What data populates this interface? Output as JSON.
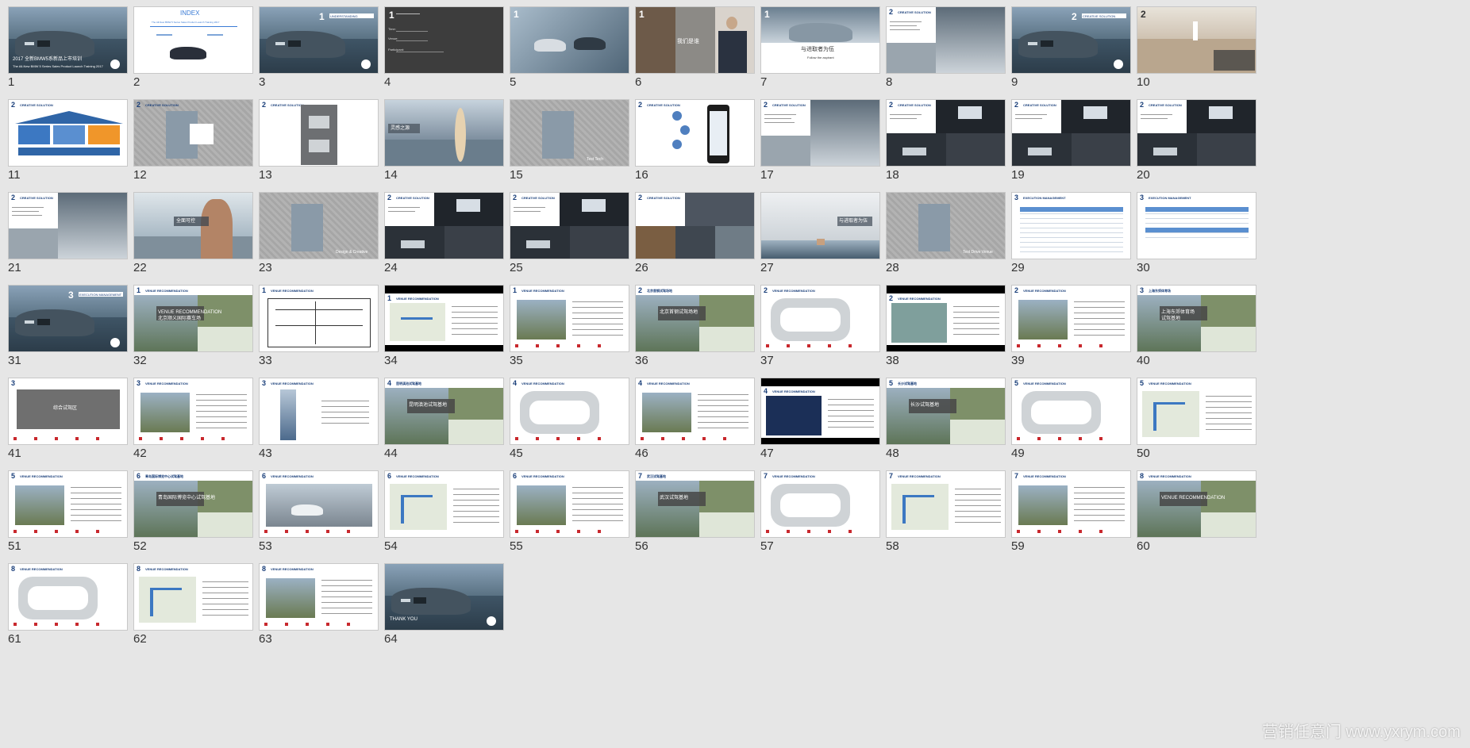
{
  "slides": [
    {
      "n": "1",
      "bg": "#3e5870",
      "texts": [
        "2017 全新BMW5系新品上市培训",
        "The All-New BMW 5 Series Sales Product Launch Training 2017"
      ],
      "kind": "car"
    },
    {
      "n": "2",
      "bg": "#ffffff",
      "texts": [
        "INDEX",
        "The All-New BMW 5 Series Sales Product Launch Training 2017"
      ],
      "kind": "index"
    },
    {
      "n": "3",
      "bg": "#5a7283",
      "texts": [
        "1",
        "UNDERSTANDING"
      ],
      "kind": "car"
    },
    {
      "n": "4",
      "bg": "#3d3d3d",
      "texts": [
        "1",
        "Time:",
        "Venue:",
        "Participant:"
      ],
      "kind": "dark"
    },
    {
      "n": "5",
      "bg": "#6f8597",
      "texts": [
        "1"
      ],
      "kind": "photo"
    },
    {
      "n": "6",
      "bg": "#5c554d",
      "texts": [
        "1",
        "我们是谁"
      ],
      "kind": "people"
    },
    {
      "n": "7",
      "bg": "#ffffff",
      "texts": [
        "1",
        "与进取者为伍",
        "Follow the aspirant"
      ],
      "kind": "car-white"
    },
    {
      "n": "8",
      "bg": "#ffffff",
      "texts": [
        "2",
        "CREATIVE SOLUTION"
      ],
      "kind": "split"
    },
    {
      "n": "9",
      "bg": "#5a7283",
      "texts": [
        "2",
        "CREATIVE SOLUTION"
      ],
      "kind": "car"
    },
    {
      "n": "10",
      "bg": "#c9b9a4",
      "texts": [
        "2"
      ],
      "kind": "sand"
    },
    {
      "n": "11",
      "bg": "#ffffff",
      "texts": [
        "2",
        "CREATIVE SOLUTION"
      ],
      "kind": "house"
    },
    {
      "n": "12",
      "bg": "#a9a9a9",
      "texts": [
        "2",
        "CREATIVE SOLUTION"
      ],
      "kind": "plan"
    },
    {
      "n": "13",
      "bg": "#ffffff",
      "texts": [
        "2",
        "CREATIVE SOLUTION"
      ],
      "kind": "floor"
    },
    {
      "n": "14",
      "bg": "#8a99a8",
      "texts": [
        "灵感之源"
      ],
      "kind": "surf"
    },
    {
      "n": "15",
      "bg": "#a9a9a9",
      "texts": [
        "Test Tech"
      ],
      "kind": "plan"
    },
    {
      "n": "16",
      "bg": "#ffffff",
      "texts": [
        "2",
        "CREATIVE SOLUTION"
      ],
      "kind": "phone"
    },
    {
      "n": "17",
      "bg": "#ffffff",
      "texts": [
        "2",
        "CREATIVE SOLUTION"
      ],
      "kind": "split"
    },
    {
      "n": "18",
      "bg": "#ffffff",
      "texts": [
        "2",
        "CREATIVE SOLUTION"
      ],
      "kind": "split-dark"
    },
    {
      "n": "19",
      "bg": "#ffffff",
      "texts": [
        "2",
        "CREATIVE SOLUTION"
      ],
      "kind": "split-dark"
    },
    {
      "n": "20",
      "bg": "#ffffff",
      "texts": [
        "2",
        "CREATIVE SOLUTION"
      ],
      "kind": "split-dark"
    },
    {
      "n": "21",
      "bg": "#ffffff",
      "texts": [
        "2",
        "CREATIVE SOLUTION"
      ],
      "kind": "split"
    },
    {
      "n": "22",
      "bg": "#b7c5cf",
      "texts": [
        "全面可控"
      ],
      "kind": "man"
    },
    {
      "n": "23",
      "bg": "#a9a9a9",
      "texts": [
        "Design & Creative"
      ],
      "kind": "plan"
    },
    {
      "n": "24",
      "bg": "#ffffff",
      "texts": [
        "2",
        "CREATIVE SOLUTION"
      ],
      "kind": "split-dark"
    },
    {
      "n": "25",
      "bg": "#ffffff",
      "texts": [
        "2",
        "CREATIVE SOLUTION"
      ],
      "kind": "split-dark"
    },
    {
      "n": "26",
      "bg": "#ffffff",
      "texts": [
        "2",
        "CREATIVE SOLUTION"
      ],
      "kind": "collage"
    },
    {
      "n": "27",
      "bg": "#dcdfe2",
      "texts": [
        "与进取者为伍"
      ],
      "kind": "wave"
    },
    {
      "n": "28",
      "bg": "#a9a9a9",
      "texts": [
        "Test Drive Venue"
      ],
      "kind": "plan"
    },
    {
      "n": "29",
      "bg": "#ffffff",
      "texts": [
        "3",
        "EXECUTION MANAGEMENT"
      ],
      "kind": "table"
    },
    {
      "n": "30",
      "bg": "#ffffff",
      "texts": [
        "3",
        "EXECUTION MANAGEMENT"
      ],
      "kind": "table2"
    },
    {
      "n": "31",
      "bg": "#5a7283",
      "texts": [
        "3",
        "EXECUTION MANAGEMENT"
      ],
      "kind": "car"
    },
    {
      "n": "32",
      "bg": "#ffffff",
      "texts": [
        "1",
        "VENUE RECOMMENDATION",
        "北京顺义国际赛车场"
      ],
      "kind": "venue-aerial"
    },
    {
      "n": "33",
      "bg": "#ffffff",
      "texts": [
        "1",
        "VENUE RECOMMENDATION"
      ],
      "kind": "drawing"
    },
    {
      "n": "34",
      "bg": "#ffffff",
      "texts": [
        "1",
        "VENUE RECOMMENDATION"
      ],
      "kind": "letterbox-map"
    },
    {
      "n": "35",
      "bg": "#ffffff",
      "texts": [
        "1",
        "VENUE RECOMMENDATION"
      ],
      "kind": "photo-text"
    },
    {
      "n": "36",
      "bg": "#ffffff",
      "texts": [
        "2",
        "北京首钢试驾场地"
      ],
      "kind": "venue-aerial"
    },
    {
      "n": "37",
      "bg": "#ffffff",
      "texts": [
        "2",
        "VENUE RECOMMENDATION"
      ],
      "kind": "track"
    },
    {
      "n": "38",
      "bg": "#ffffff",
      "texts": [
        "2",
        "VENUE RECOMMENDATION"
      ],
      "kind": "letterbox-photo"
    },
    {
      "n": "39",
      "bg": "#ffffff",
      "texts": [
        "2",
        "VENUE RECOMMENDATION"
      ],
      "kind": "photo-text"
    },
    {
      "n": "40",
      "bg": "#ffffff",
      "texts": [
        "3",
        "上海东郊体育场",
        "试驾基地"
      ],
      "kind": "venue-aerial"
    },
    {
      "n": "41",
      "bg": "#ffffff",
      "texts": [
        "3",
        "综合试驾区"
      ],
      "kind": "grey-box"
    },
    {
      "n": "42",
      "bg": "#ffffff",
      "texts": [
        "3",
        "VENUE RECOMMENDATION"
      ],
      "kind": "photo-text"
    },
    {
      "n": "43",
      "bg": "#ffffff",
      "texts": [
        "3",
        "VENUE RECOMMENDATION"
      ],
      "kind": "tower"
    },
    {
      "n": "44",
      "bg": "#ffffff",
      "texts": [
        "4",
        "昆明滇池试驾基地"
      ],
      "kind": "venue-aerial"
    },
    {
      "n": "45",
      "bg": "#ffffff",
      "texts": [
        "4",
        "VENUE RECOMMENDATION"
      ],
      "kind": "track"
    },
    {
      "n": "46",
      "bg": "#ffffff",
      "texts": [
        "4",
        "VENUE RECOMMENDATION"
      ],
      "kind": "photo-text"
    },
    {
      "n": "47",
      "bg": "#ffffff",
      "texts": [
        "4",
        "VENUE RECOMMENDATION"
      ],
      "kind": "letterbox-photo"
    },
    {
      "n": "48",
      "bg": "#ffffff",
      "texts": [
        "5",
        "长沙试驾基地"
      ],
      "kind": "venue-aerial"
    },
    {
      "n": "49",
      "bg": "#ffffff",
      "texts": [
        "5",
        "VENUE RECOMMENDATION"
      ],
      "kind": "track"
    },
    {
      "n": "50",
      "bg": "#ffffff",
      "texts": [
        "5",
        "VENUE RECOMMENDATION"
      ],
      "kind": "map-text"
    },
    {
      "n": "51",
      "bg": "#ffffff",
      "texts": [
        "5",
        "VENUE RECOMMENDATION"
      ],
      "kind": "photo-text"
    },
    {
      "n": "52",
      "bg": "#ffffff",
      "texts": [
        "6",
        "青岛国际博览中心试驾基地"
      ],
      "kind": "venue-aerial"
    },
    {
      "n": "53",
      "bg": "#ffffff",
      "texts": [
        "6",
        "VENUE RECOMMENDATION"
      ],
      "kind": "car-lot"
    },
    {
      "n": "54",
      "bg": "#ffffff",
      "texts": [
        "6",
        "VENUE RECOMMENDATION"
      ],
      "kind": "map-text"
    },
    {
      "n": "55",
      "bg": "#ffffff",
      "texts": [
        "6",
        "VENUE RECOMMENDATION"
      ],
      "kind": "photo-text"
    },
    {
      "n": "56",
      "bg": "#ffffff",
      "texts": [
        "7",
        "武汉试驾基地"
      ],
      "kind": "venue-aerial"
    },
    {
      "n": "57",
      "bg": "#ffffff",
      "texts": [
        "7",
        "VENUE RECOMMENDATION"
      ],
      "kind": "track"
    },
    {
      "n": "58",
      "bg": "#ffffff",
      "texts": [
        "7",
        "VENUE RECOMMENDATION"
      ],
      "kind": "map-text"
    },
    {
      "n": "59",
      "bg": "#ffffff",
      "texts": [
        "7",
        "VENUE RECOMMENDATION"
      ],
      "kind": "photo-text"
    },
    {
      "n": "60",
      "bg": "#ffffff",
      "texts": [
        "8",
        "VENUE RECOMMENDATION"
      ],
      "kind": "venue-aerial"
    },
    {
      "n": "61",
      "bg": "#ffffff",
      "texts": [
        "8",
        "VENUE RECOMMENDATION"
      ],
      "kind": "track"
    },
    {
      "n": "62",
      "bg": "#ffffff",
      "texts": [
        "8",
        "VENUE RECOMMENDATION"
      ],
      "kind": "map-text"
    },
    {
      "n": "63",
      "bg": "#ffffff",
      "texts": [
        "8",
        "VENUE RECOMMENDATION"
      ],
      "kind": "photo-text"
    },
    {
      "n": "64",
      "bg": "#4e6476",
      "texts": [
        "THANK YOU"
      ],
      "kind": "car"
    }
  ],
  "watermark": "营销任意门 www.yxrym.com",
  "colors": {
    "background": "#e6e6e6",
    "accent": "#1a3f7a",
    "red": "#c8282d"
  }
}
